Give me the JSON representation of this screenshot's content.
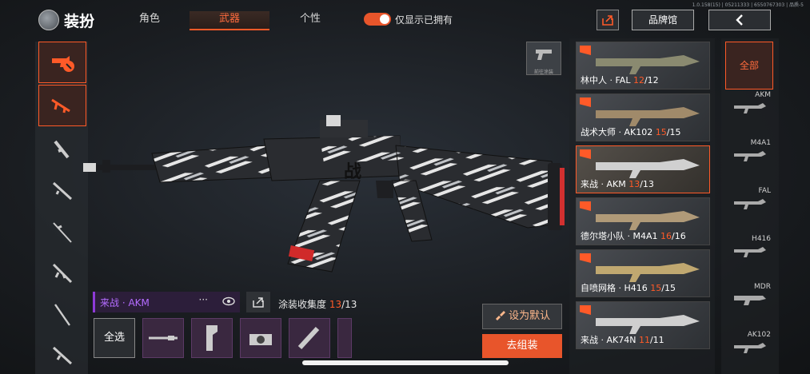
{
  "version_text": "1.0.158(15) | 05211333 | 6550767303 | 品质-5",
  "header": {
    "title": "装扮",
    "tabs": [
      {
        "label": "角色",
        "active": false
      },
      {
        "label": "武器",
        "active": true
      },
      {
        "label": "个性",
        "active": false
      }
    ],
    "owned_toggle_label": "仅显示已拥有",
    "owned_toggle_on": true,
    "brand_button": "品牌馆"
  },
  "paint_button_label": "前往涂装",
  "selected_skin": {
    "name": "来战 · AKM",
    "more": "···",
    "collection_label": "涂装收集度",
    "collection_current": "13",
    "collection_total": "/13"
  },
  "select_all_label": "全选",
  "actions": {
    "set_default": "设为默认",
    "go_assemble": "去组装"
  },
  "skins": [
    {
      "name": "林中人 · FAL ",
      "count": "12",
      "total": "/12",
      "selected": false
    },
    {
      "name": "战术大师 · AK102 ",
      "count": "15",
      "total": "/15",
      "selected": false
    },
    {
      "name": "来战 · AKM ",
      "count": "13",
      "total": "/13",
      "selected": true
    },
    {
      "name": "德尔塔小队 · M4A1 ",
      "count": "16",
      "total": "/16",
      "selected": false
    },
    {
      "name": "自喷网格 · H416 ",
      "count": "15",
      "total": "/15",
      "selected": false
    },
    {
      "name": "来战 · AK74N ",
      "count": "11",
      "total": "/11",
      "selected": false
    }
  ],
  "weapon_filter": {
    "all_label": "全部",
    "types": [
      "AKM",
      "M4A1",
      "FAL",
      "H416",
      "MDR",
      "AK102"
    ]
  },
  "colors": {
    "accent": "#ff5a28",
    "rare_purple": "#b46cff"
  }
}
